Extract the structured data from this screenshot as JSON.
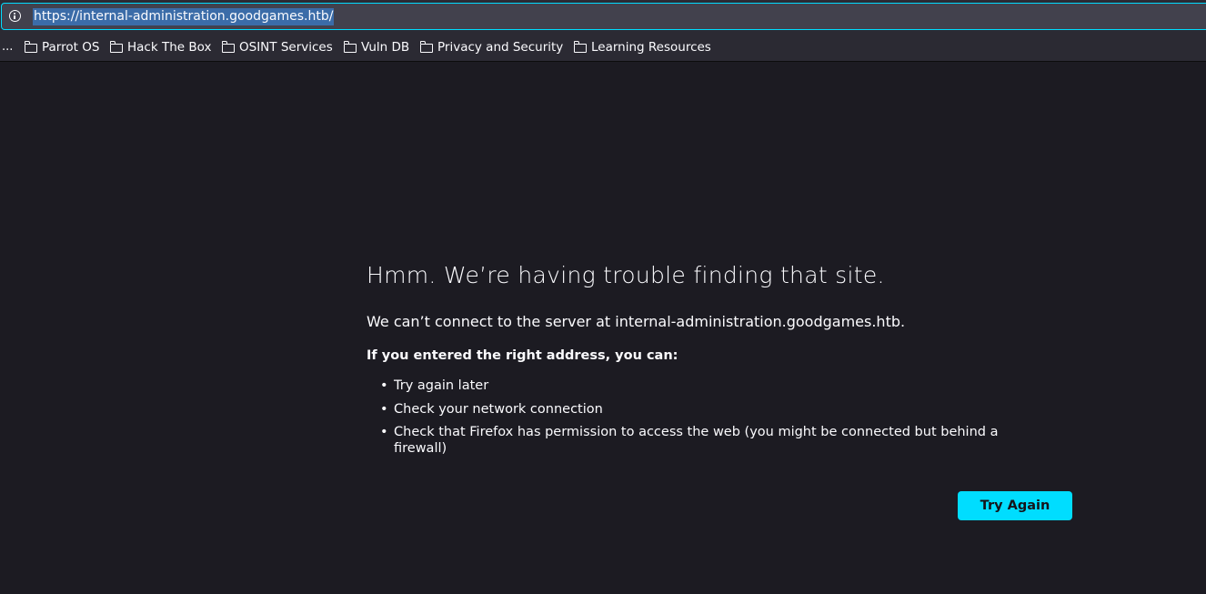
{
  "urlbar": {
    "url": "https://internal-administration.goodgames.htb/",
    "icon": "info-icon"
  },
  "bookmarks": {
    "overflow": "...",
    "items": [
      {
        "label": "Parrot OS",
        "icon": "folder-icon"
      },
      {
        "label": "Hack The Box",
        "icon": "folder-icon"
      },
      {
        "label": "OSINT Services",
        "icon": "folder-icon"
      },
      {
        "label": "Vuln DB",
        "icon": "folder-icon"
      },
      {
        "label": "Privacy and Security",
        "icon": "folder-icon"
      },
      {
        "label": "Learning Resources",
        "icon": "folder-icon"
      }
    ]
  },
  "error": {
    "title": "Hmm. We’re having trouble finding that site.",
    "description": "We can’t connect to the server at internal-administration.goodgames.htb.",
    "hint": "If you entered the right address, you can:",
    "suggestions": [
      "Try again later",
      "Check your network connection",
      "Check that Firefox has permission to access the web (you might be connected but behind a firewall)"
    ],
    "button_label": "Try Again"
  },
  "colors": {
    "page_background": "#1c1b22",
    "toolbar_background": "#2b2a33",
    "urlbar_background": "#42414d",
    "accent": "#00ddff",
    "text": "#fbfbfe",
    "url_selection": "#3b6ca8"
  }
}
